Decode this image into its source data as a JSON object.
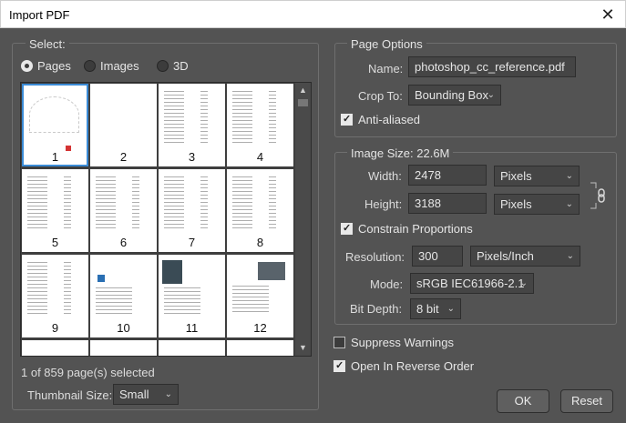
{
  "window": {
    "title": "Import PDF",
    "close_glyph": "✕"
  },
  "select": {
    "legend": "Select:",
    "options": [
      {
        "label": "Pages",
        "selected": true
      },
      {
        "label": "Images",
        "selected": false
      },
      {
        "label": "3D",
        "selected": false
      }
    ],
    "thumbnails": [
      "1",
      "2",
      "3",
      "4",
      "5",
      "6",
      "7",
      "8",
      "9",
      "10",
      "11",
      "12"
    ],
    "status": "1 of 859 page(s) selected",
    "thumbnail_size_label": "Thumbnail Size:",
    "thumbnail_size_value": "Small"
  },
  "page_options": {
    "legend": "Page Options",
    "name_label": "Name:",
    "name_value": "photoshop_cc_reference.pdf",
    "crop_label": "Crop To:",
    "crop_value": "Bounding Box",
    "anti_aliased": "Anti-aliased"
  },
  "image_size": {
    "legend": "Image Size: 22.6M",
    "width_label": "Width:",
    "width_value": "2478",
    "width_unit": "Pixels",
    "height_label": "Height:",
    "height_value": "3188",
    "height_unit": "Pixels",
    "constrain": "Constrain Proportions",
    "resolution_label": "Resolution:",
    "resolution_value": "300",
    "resolution_unit": "Pixels/Inch",
    "mode_label": "Mode:",
    "mode_value": "sRGB IEC61966-2.1",
    "bitdepth_label": "Bit Depth:",
    "bitdepth_value": "8 bit"
  },
  "options": {
    "suppress": "Suppress Warnings",
    "reverse": "Open In Reverse Order"
  },
  "buttons": {
    "ok": "OK",
    "reset": "Reset"
  },
  "icons": {
    "chevron": "chevron-down-icon",
    "link": "link-icon"
  }
}
